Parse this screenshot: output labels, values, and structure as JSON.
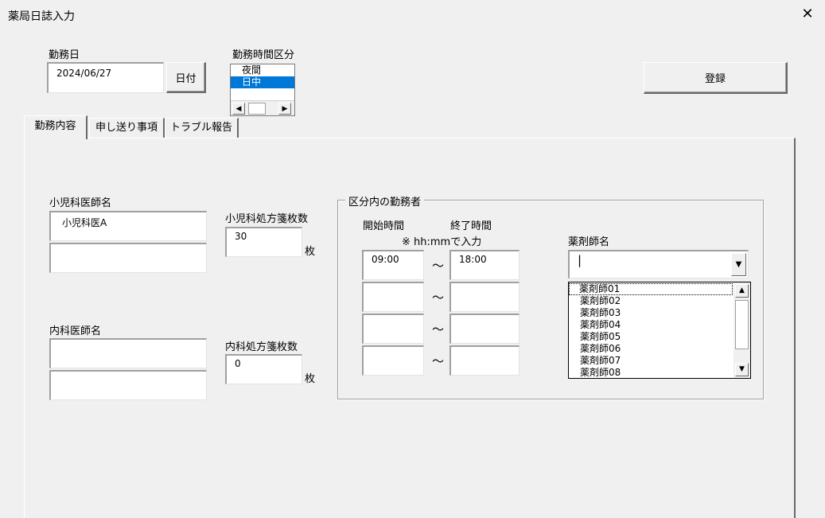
{
  "window": {
    "title": "薬局日誌入力",
    "close": "✕"
  },
  "work_date": {
    "label": "勤務日",
    "value": "2024/06/27",
    "date_button": "日付"
  },
  "shift": {
    "label": "勤務時間区分",
    "options": [
      "夜間",
      "日中"
    ],
    "selected": "日中"
  },
  "register_button": "登録",
  "tabs": [
    {
      "label": "勤務内容",
      "active": true
    },
    {
      "label": "申し送り事項",
      "active": false
    },
    {
      "label": "トラブル報告",
      "active": false
    }
  ],
  "pediatrics": {
    "doctor_label": "小児科医師名",
    "doctor_values": [
      "小児科医A",
      ""
    ],
    "count_label": "小児科処方箋枚数",
    "count_value": "30",
    "unit": "枚"
  },
  "internal": {
    "doctor_label": "内科医師名",
    "doctor_values": [
      "",
      ""
    ],
    "count_label": "内科処方箋枚数",
    "count_value": "0",
    "unit": "枚"
  },
  "staff": {
    "frame_label": "区分内の勤務者",
    "start_label": "開始時間",
    "end_label": "終了時間",
    "hint": "※ hh:mmで入力",
    "tilde": "～",
    "start_values": [
      "09:00",
      "",
      "",
      ""
    ],
    "end_values": [
      "18:00",
      "",
      "",
      ""
    ],
    "pharmacist_label": "薬剤師名",
    "pharmacist_value": "|",
    "pharmacist_options": [
      "薬剤師01",
      "薬剤師02",
      "薬剤師03",
      "薬剤師04",
      "薬剤師05",
      "薬剤師06",
      "薬剤師07",
      "薬剤師08"
    ]
  },
  "icons": {
    "close": "close-icon",
    "scroll_left": "arrow-left-icon",
    "scroll_right": "arrow-right-icon",
    "dropdown": "chevron-down-icon",
    "scroll_up": "arrow-up-icon",
    "scroll_down": "arrow-down-icon"
  },
  "colors": {
    "selection": "#0078d7",
    "background": "#f0f0f0"
  }
}
